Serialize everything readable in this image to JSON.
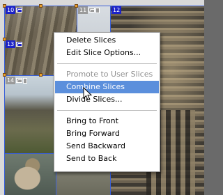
{
  "slice_badges": [
    {
      "number": "10",
      "type": "user"
    },
    {
      "number": "11",
      "type": "auto"
    },
    {
      "number": "12",
      "type": "user"
    },
    {
      "number": "13",
      "type": "user"
    },
    {
      "number": "14",
      "type": "auto"
    }
  ],
  "context_menu": {
    "items": [
      {
        "label": "Delete Slices",
        "state": "enabled"
      },
      {
        "label": "Edit Slice Options...",
        "state": "enabled"
      },
      {
        "separator": true
      },
      {
        "label": "Promote to User Slices",
        "state": "disabled"
      },
      {
        "label": "Combine Slices",
        "state": "highlighted"
      },
      {
        "label": "Divide Slices...",
        "state": "enabled"
      },
      {
        "separator": true
      },
      {
        "label": "Bring to Front",
        "state": "enabled"
      },
      {
        "label": "Bring Forward",
        "state": "enabled"
      },
      {
        "label": "Send Backward",
        "state": "enabled"
      },
      {
        "label": "Send to Back",
        "state": "enabled"
      }
    ]
  },
  "colors": {
    "user_slice_badge": "#1c22c8",
    "auto_slice_badge": "#9a9a9a",
    "slice_line": "#3a60d8",
    "handle": "#e8a030",
    "menu_highlight": "#5b8fdc"
  },
  "icons": [
    "slice-image-icon",
    "slice-link-icon",
    "arrow-cursor-icon"
  ]
}
